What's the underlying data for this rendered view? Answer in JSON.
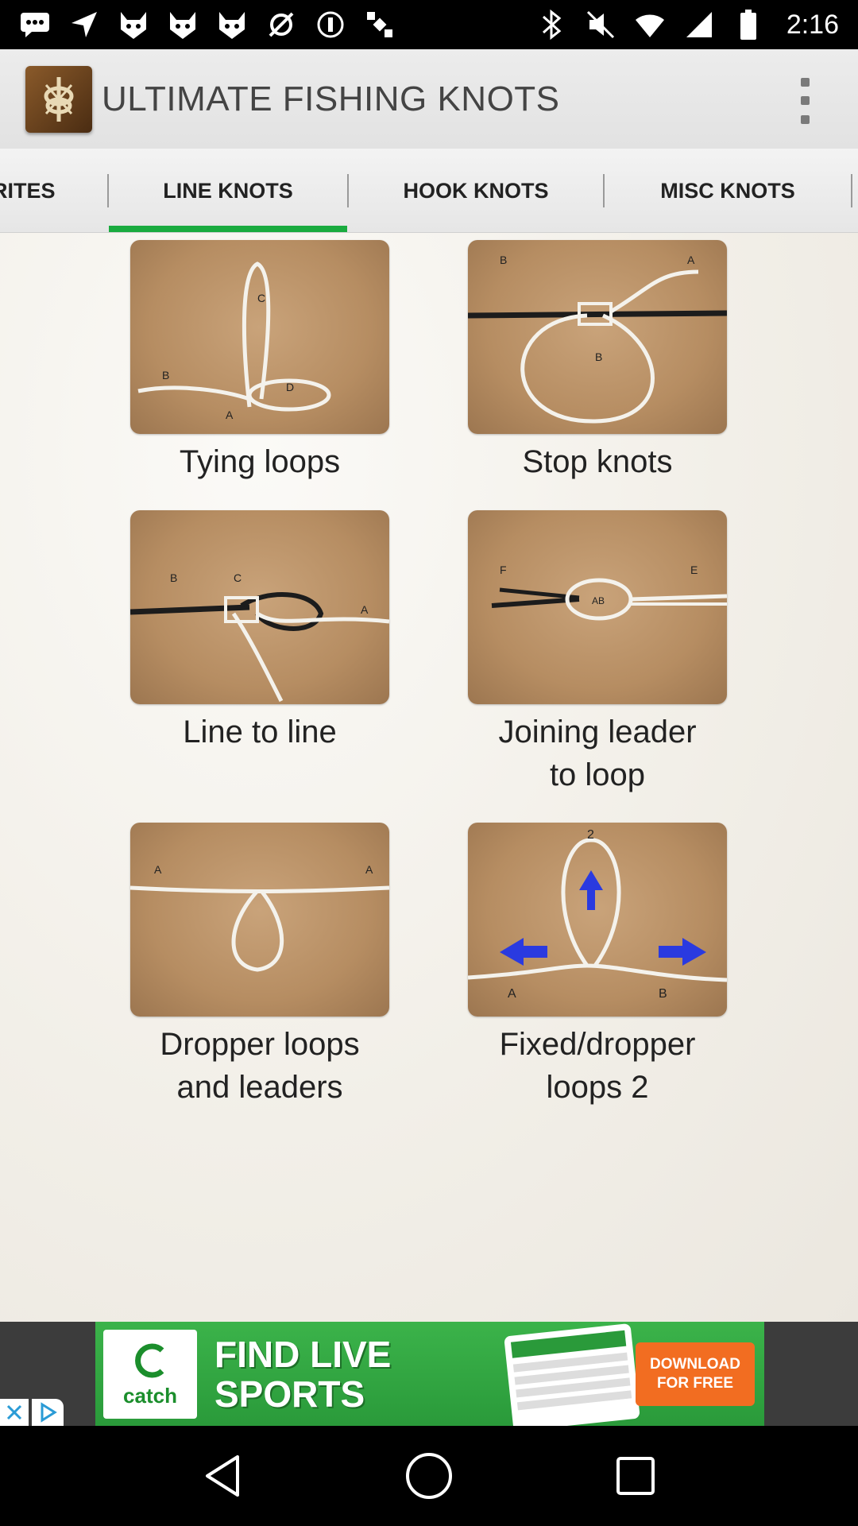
{
  "status_bar": {
    "time": "2:16",
    "left_icons": [
      "message-icon",
      "navigation-icon",
      "cat-face-icon",
      "cat-face-icon",
      "cat-face-icon",
      "fake-gps-icon",
      "circle-p-icon",
      "satellite-icon"
    ],
    "right_icons": [
      "bluetooth-icon",
      "mute-icon",
      "wifi-icon",
      "signal-icon",
      "battery-icon"
    ]
  },
  "app_bar": {
    "title": "ULTIMATE FISHING KNOTS",
    "logo_icon": "knot-logo-icon",
    "menu_icon": "overflow-menu-icon"
  },
  "tabs": [
    {
      "label": "FAVORITES",
      "visible_label": "RITES",
      "selected": false
    },
    {
      "label": "LINE KNOTS",
      "visible_label": "LINE KNOTS",
      "selected": true
    },
    {
      "label": "HOOK KNOTS",
      "visible_label": "HOOK KNOTS",
      "selected": false
    },
    {
      "label": "MISC KNOTS",
      "visible_label": "MISC KNOTS",
      "selected": false
    }
  ],
  "accent_color": "#1aab3f",
  "knots": [
    {
      "title": "Tying loops",
      "image": "tying-loops-thumbnail"
    },
    {
      "title": "Stop knots",
      "image": "stop-knots-thumbnail"
    },
    {
      "title": "Line to line",
      "image": "line-to-line-thumbnail"
    },
    {
      "title": "Joining leader to loop",
      "title_line1": "Joining leader",
      "title_line2": "to loop",
      "image": "joining-leader-thumbnail"
    },
    {
      "title": "Dropper loops and leaders",
      "title_line1": "Dropper loops",
      "title_line2": "and leaders",
      "image": "dropper-loops-thumbnail"
    },
    {
      "title": "Fixed/dropper loops 2",
      "title_line1": "Fixed/dropper",
      "title_line2": "loops 2",
      "image": "fixed-dropper-thumbnail"
    }
  ],
  "ad": {
    "brand": "catch",
    "sub_brand": "SPORTS",
    "headline_line1": "FIND LIVE",
    "headline_line2": "SPORTS",
    "cta_line1": "DOWNLOAD",
    "cta_line2": "FOR FREE",
    "brand_color": "#2a9a3a",
    "cta_color": "#f26d21"
  },
  "nav_bar": {
    "buttons": [
      "back-icon",
      "home-icon",
      "recents-icon"
    ]
  }
}
